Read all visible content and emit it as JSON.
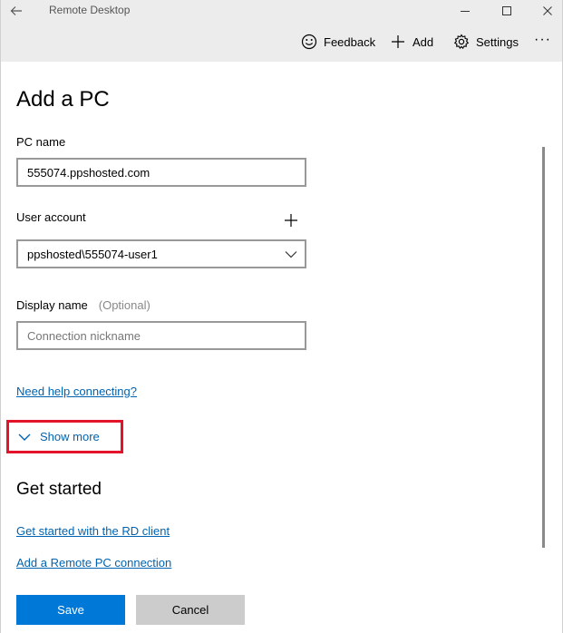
{
  "window": {
    "title": "Remote Desktop",
    "controls": {
      "minimize_icon": "minimize-icon",
      "maximize_icon": "maximize-icon",
      "close_icon": "close-icon"
    }
  },
  "commandbar": {
    "feedback_label": "Feedback",
    "add_label": "Add",
    "settings_label": "Settings",
    "more_label": "···"
  },
  "form": {
    "page_title": "Add a PC",
    "pc_name_label": "PC name",
    "pc_name_value": "555074.ppshosted.com",
    "user_account_label": "User account",
    "user_account_value": "ppshosted\\555074-user1",
    "display_name_label": "Display name",
    "display_name_optional": "(Optional)",
    "display_name_placeholder": "Connection nickname",
    "help_link": "Need help connecting?",
    "show_more_label": "Show more"
  },
  "get_started": {
    "title": "Get started",
    "links": [
      "Get started with the RD client",
      "Add a Remote PC connection"
    ]
  },
  "buttons": {
    "save_label": "Save",
    "cancel_label": "Cancel"
  },
  "colors": {
    "accent": "#0078d7",
    "link": "#0063b1",
    "highlight_box": "#e3142a",
    "chrome_bg": "#ececec"
  }
}
